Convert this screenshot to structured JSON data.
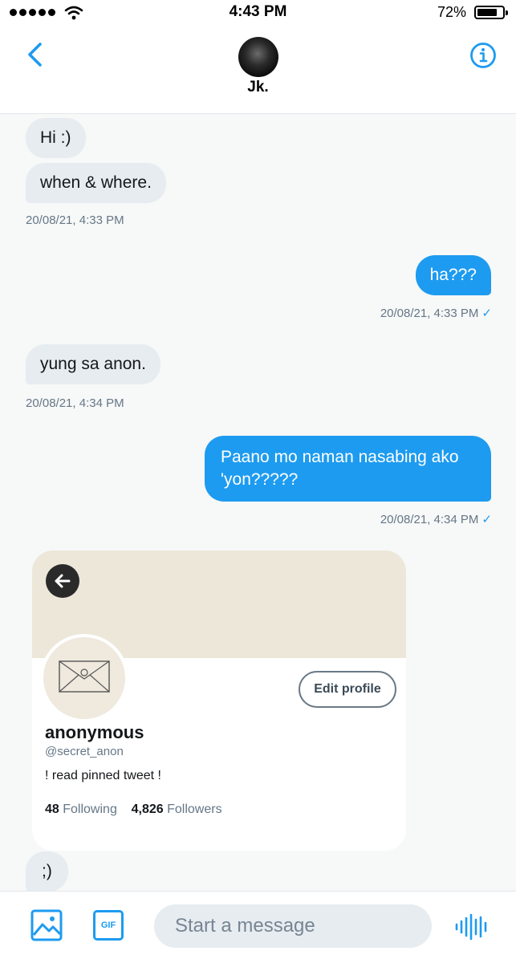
{
  "status_bar": {
    "time": "4:43 PM",
    "battery": "72%"
  },
  "header": {
    "contact_name": "Jk."
  },
  "messages": [
    {
      "side": "received",
      "text": "Hi :)"
    },
    {
      "side": "received",
      "text": "when & where."
    },
    {
      "side": "timestamp",
      "text": "20/08/21, 4:33 PM"
    },
    {
      "side": "sent",
      "text": "ha???"
    },
    {
      "side": "timestamp",
      "text": "20/08/21, 4:33 PM"
    },
    {
      "side": "received",
      "text": "yung sa anon."
    },
    {
      "side": "timestamp",
      "text": "20/08/21, 4:34 PM"
    },
    {
      "side": "sent",
      "text": "Paano mo naman nasabing ako 'yon?????"
    },
    {
      "side": "timestamp",
      "text": "20/08/21, 4:34 PM"
    },
    {
      "side": "received",
      "text": ";)"
    }
  ],
  "shared_profile": {
    "edit_button": "Edit profile",
    "name": "anonymous",
    "handle": "@secret_anon",
    "bio": "! read pinned tweet !",
    "following_count": "48",
    "following_label": "Following",
    "followers_count": "4,826",
    "followers_label": "Followers"
  },
  "composer": {
    "placeholder": "Start a message",
    "gif_label": "GIF"
  },
  "icons": [
    "signal-icon",
    "wifi-icon",
    "battery-icon",
    "back-arrow-icon",
    "info-icon",
    "image-icon",
    "gif-icon",
    "voice-icon",
    "check-icon"
  ],
  "colors": {
    "accent": "#1d9bf0",
    "received_bubble": "#e6ecf0",
    "timestamp": "#657786"
  }
}
